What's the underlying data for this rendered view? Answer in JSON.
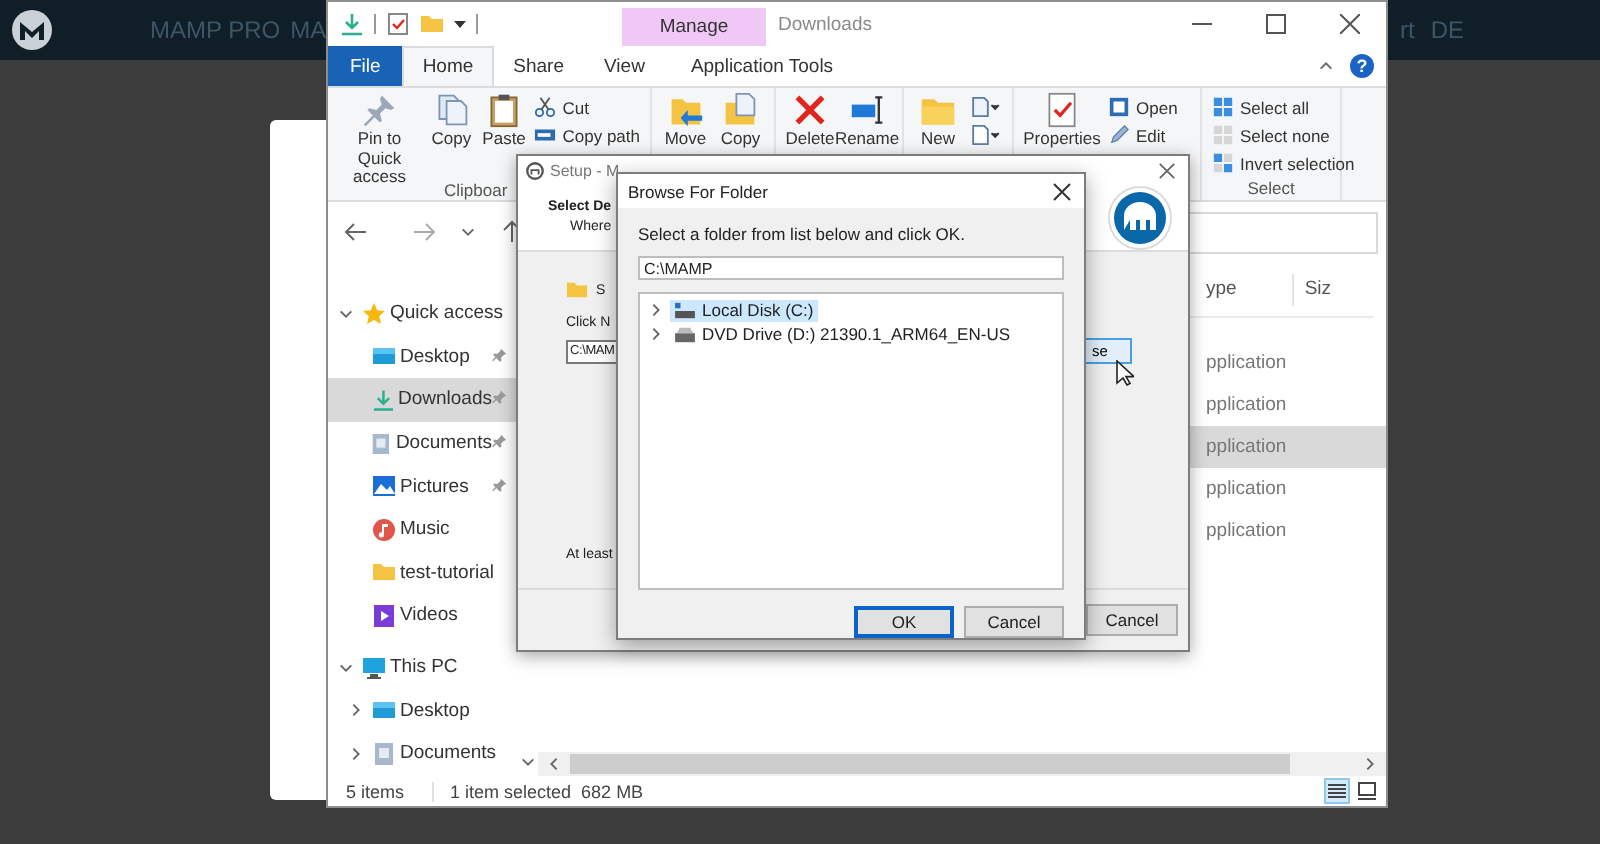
{
  "site_header": {
    "nav": [
      {
        "label": "MAMP PRO"
      },
      {
        "label": "MA"
      },
      {
        "label": "rt"
      },
      {
        "label": "DE"
      }
    ]
  },
  "explorer": {
    "context_group": "Manage",
    "title": "Downloads",
    "help": "?",
    "tabs": [
      {
        "label": "File",
        "kind": "file",
        "selected": false
      },
      {
        "label": "Home",
        "kind": "tab",
        "selected": true
      },
      {
        "label": "Share",
        "kind": "tab",
        "selected": false
      },
      {
        "label": "View",
        "kind": "tab",
        "selected": false
      },
      {
        "label": "Application Tools",
        "kind": "context",
        "selected": false
      }
    ],
    "ribbon": [
      {
        "group": "Clipboar",
        "commands": [
          {
            "kind": "pin",
            "label": "Pin to Quick access"
          },
          {
            "kind": "copy",
            "label": "Copy"
          },
          {
            "kind": "paste",
            "label": "Paste"
          },
          {
            "kind": "cut",
            "label": "Cut"
          },
          {
            "kind": "copy_path",
            "label": "Copy path"
          }
        ]
      },
      {
        "commands": [
          {
            "kind": "move",
            "label": "Move"
          },
          {
            "kind": "copy_to",
            "label": "Copy"
          }
        ]
      },
      {
        "commands": [
          {
            "kind": "delete",
            "label": "Delete"
          },
          {
            "kind": "rename",
            "label": "Rename"
          }
        ]
      },
      {
        "commands": [
          {
            "kind": "new_folder",
            "label": "New"
          },
          {
            "kind": "new_item"
          },
          {
            "kind": "easy_access"
          }
        ]
      },
      {
        "commands": [
          {
            "kind": "properties",
            "label": "Properties"
          },
          {
            "kind": "open",
            "label": "Open"
          },
          {
            "kind": "edit",
            "label": "Edit"
          }
        ]
      },
      {
        "group": "Select",
        "commands": [
          {
            "kind": "select_all",
            "label": "Select all"
          },
          {
            "kind": "select_none",
            "label": "Select none"
          },
          {
            "kind": "invert",
            "label": "Invert selection"
          }
        ]
      }
    ],
    "nav_pane": [
      {
        "label": "Quick access",
        "kind": "star",
        "expanded": true,
        "selected": false,
        "children": [
          {
            "label": "Desktop",
            "kind": "desktop",
            "pinned": true,
            "selected": false
          },
          {
            "label": "Downloads",
            "kind": "downloads",
            "pinned": true,
            "selected": true
          },
          {
            "label": "Documents",
            "kind": "documents",
            "pinned": true,
            "selected": false
          },
          {
            "label": "Pictures",
            "kind": "pictures",
            "pinned": true,
            "selected": false
          },
          {
            "label": "Music",
            "kind": "music",
            "pinned": false,
            "selected": false
          },
          {
            "label": "test-tutorial",
            "kind": "folder",
            "pinned": false,
            "selected": false
          },
          {
            "label": "Videos",
            "kind": "videos",
            "pinned": false,
            "selected": false
          }
        ]
      },
      {
        "label": "This PC",
        "kind": "pc",
        "expanded": true,
        "selected": false,
        "children": [
          {
            "label": "Desktop",
            "kind": "desktop",
            "expanded": false,
            "selected": false
          },
          {
            "label": "Documents",
            "kind": "documents",
            "expanded": false,
            "selected": false
          }
        ]
      }
    ],
    "file_list": {
      "columns": [
        "ype",
        "Siz"
      ],
      "rows": [
        {
          "type": "pplication",
          "selected": false
        },
        {
          "type": "pplication",
          "selected": false
        },
        {
          "type": "pplication",
          "selected": true
        },
        {
          "type": "pplication",
          "selected": false
        },
        {
          "type": "pplication",
          "selected": false
        }
      ]
    },
    "status_bar": {
      "item_count": "5 items",
      "selection": "1 item selected",
      "size": "682 MB"
    },
    "view_buttons": [
      {
        "kind": "details",
        "selected": true
      },
      {
        "kind": "tiles",
        "selected": false
      }
    ]
  },
  "setup_dialog": {
    "title": "Setup - M",
    "heading": "Select De",
    "subheading": "Where",
    "folder_text": "S",
    "instruction": "Click N",
    "path": "C:\\MAM",
    "browse_button": "se",
    "note": "At least",
    "cancel": "Cancel"
  },
  "browse_dialog": {
    "title": "Browse For Folder",
    "prompt": "Select a folder from list below and click OK.",
    "path": "C:\\MAMP",
    "tree": [
      {
        "label": "Local Disk (C:)",
        "kind": "disk",
        "selected": true,
        "expanded": false
      },
      {
        "label": "DVD Drive (D:) 21390.1_ARM64_EN-US",
        "kind": "dvd",
        "selected": false,
        "expanded": false
      }
    ],
    "buttons": [
      {
        "label": "OK",
        "kind": "default"
      },
      {
        "label": "Cancel",
        "kind": "normal"
      }
    ]
  }
}
